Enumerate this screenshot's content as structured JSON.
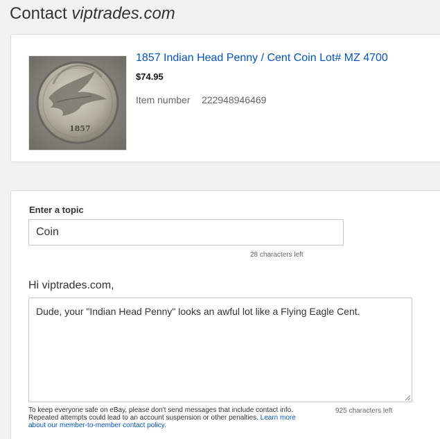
{
  "header": {
    "title_prefix": "Contact ",
    "seller": "viptrades.com"
  },
  "item": {
    "image_icon": "coin-photo",
    "title": "1857 Indian Head Penny / Cent Coin Lot# MZ 4700",
    "price": "$74.95",
    "number_label": "Item number",
    "number_value": "222948946469"
  },
  "form": {
    "topic_label": "Enter a topic",
    "topic_value": "Coin",
    "topic_count": "28 characters left",
    "greeting": "Hi viptrades.com,",
    "message_value": "Dude, your \"Indian Head Penny\" looks an awful lot like a Flying Eagle Cent.",
    "message_count": "925 characters left",
    "disclaimer_text": "To keep everyone safe on eBay, please don't send messages that include contact info. Repeated attempts could lead to an account suspension or other penalties. ",
    "policy_link": "Learn more about our member-to-member contact policy."
  },
  "colors": {
    "link": "#0654ba",
    "background": "#f2f2f2",
    "card": "#ffffff"
  }
}
